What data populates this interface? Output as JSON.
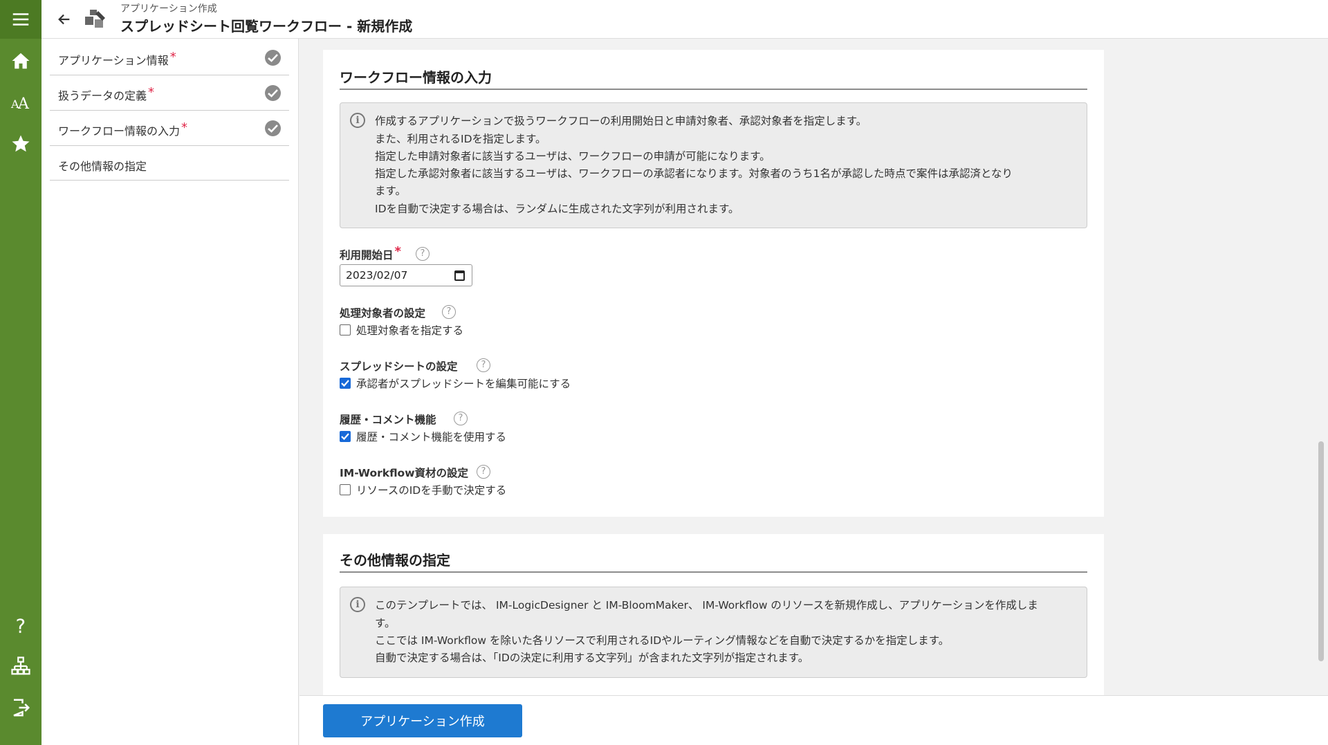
{
  "header": {
    "breadcrumb": "アプリケーション作成",
    "title": "スプレッドシート回覧ワークフロー - 新規作成"
  },
  "rail": {
    "icons": [
      "menu-icon",
      "home-icon",
      "font-icon",
      "star-icon",
      "help-icon",
      "sitemap-icon",
      "logout-icon"
    ],
    "color": "#5a8a2e"
  },
  "steps": [
    {
      "label": "アプリケーション情報",
      "required": "*",
      "done": true
    },
    {
      "label": "扱うデータの定義",
      "required": "*",
      "done": true
    },
    {
      "label": "ワークフロー情報の入力",
      "required": "*",
      "done": true
    },
    {
      "label": "その他情報の指定",
      "required": "",
      "done": false
    }
  ],
  "workflow": {
    "title": "ワークフロー情報の入力",
    "info": [
      "作成するアプリケーションで扱うワークフローの利用開始日と申請対象者、承認対象者を指定します。",
      "また、利用されるIDを指定します。",
      "指定した申請対象者に該当するユーザは、ワークフローの申請が可能になります。",
      "指定した承認対象者に該当するユーザは、ワークフローの承認者になります。対象者のうち1名が承認した時点で案件は承認済となり",
      "ます。",
      "IDを自動で決定する場合は、ランダムに生成された文字列が利用されます。"
    ],
    "start_date_label": "利用開始日",
    "start_date_required": "*",
    "start_date_value": "2023/02/07",
    "processor_label": "処理対象者の設定",
    "processor_checkbox": "処理対象者を指定する",
    "processor_checked": false,
    "spreadsheet_label": "スプレッドシートの設定",
    "spreadsheet_checkbox": "承認者がスプレッドシートを編集可能にする",
    "spreadsheet_checked": true,
    "history_label": "履歴・コメント機能",
    "history_checkbox": "履歴・コメント機能を使用する",
    "history_checked": true,
    "resource_label": "IM-Workflow資材の設定",
    "resource_checkbox": "リソースのIDを手動で決定する",
    "resource_checked": false
  },
  "other": {
    "title": "その他情報の指定",
    "info": [
      "このテンプレートでは、 IM-LogicDesigner と IM-BloomMaker、 IM-Workflow のリソースを新規作成し、アプリケーションを作成しま",
      "す。",
      "ここでは IM-Workflow を除いた各リソースで利用されるIDやルーティング情報などを自動で決定するかを指定します。",
      "自動で決定する場合は、「IDの決定に利用する文字列」が含まれた文字列が指定されます。"
    ]
  },
  "footer": {
    "create_button": "アプリケーション作成",
    "button_color": "#1e7ad1"
  }
}
